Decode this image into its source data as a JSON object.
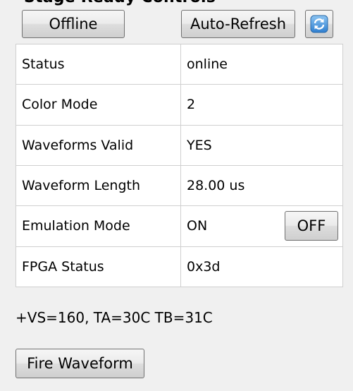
{
  "header_clipped_text": "Stage Ready Controls",
  "toolbar": {
    "offline_label": "Offline",
    "auto_refresh_label": "Auto-Refresh",
    "refresh_icon": "refresh-icon"
  },
  "status_table": {
    "rows": [
      {
        "label": "Status",
        "value": "online"
      },
      {
        "label": "Color Mode",
        "value": "2"
      },
      {
        "label": "Waveforms Valid",
        "value": "YES"
      },
      {
        "label": "Waveform Length",
        "value": "28.00 us"
      },
      {
        "label": "Emulation Mode",
        "value": "ON",
        "button": "OFF"
      },
      {
        "label": "FPGA Status",
        "value": "0x3d"
      }
    ]
  },
  "status_line": "+VS=160, TA=30C TB=31C",
  "fire_button_label": "Fire Waveform",
  "colors": {
    "background": "#f0f0f0",
    "table_background": "#ffffff",
    "refresh_icon_blue": "#2f7fd0"
  }
}
